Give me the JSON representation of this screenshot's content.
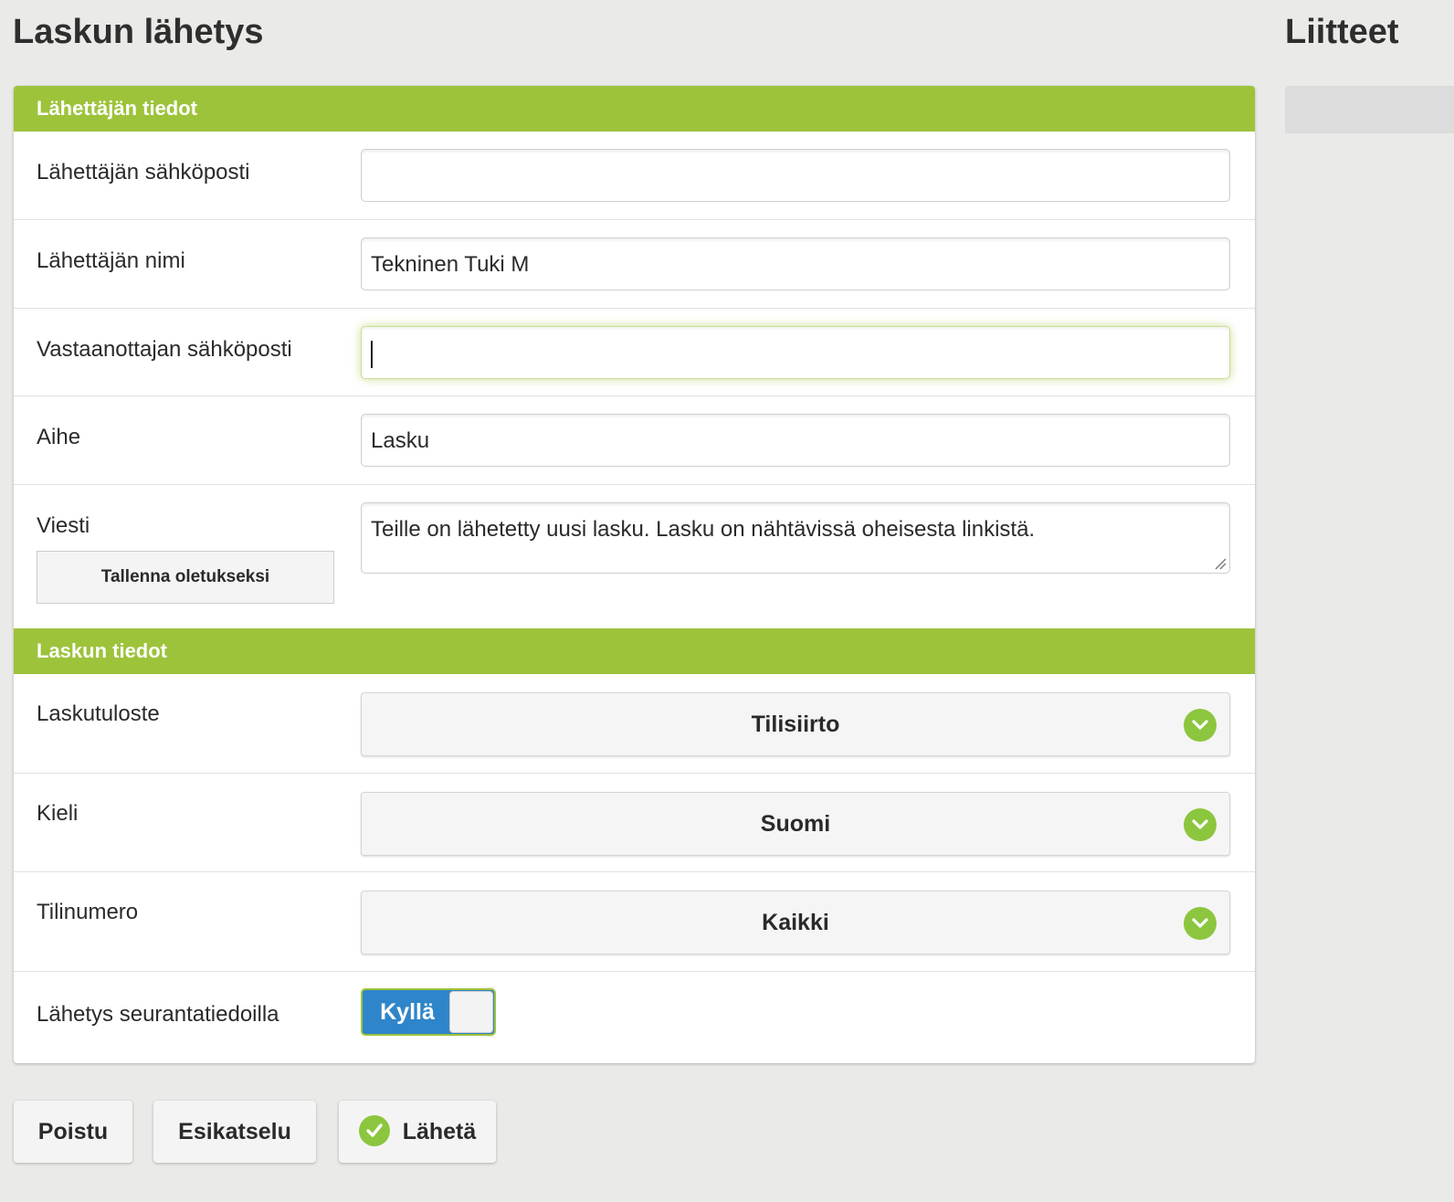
{
  "page": {
    "title": "Laskun lähetys"
  },
  "sidebar": {
    "title": "Liitteet"
  },
  "sender_section": {
    "header": "Lähettäjän tiedot",
    "fields": {
      "sender_email": {
        "label": "Lähettäjän sähköposti",
        "value": ""
      },
      "sender_name": {
        "label": "Lähettäjän nimi",
        "value": "Tekninen Tuki M"
      },
      "recipient_email": {
        "label": "Vastaanottajan sähköposti",
        "value": ""
      },
      "subject": {
        "label": "Aihe",
        "value": "Lasku"
      },
      "message": {
        "label": "Viesti",
        "value": "Teille on lähetetty uusi lasku. Lasku on nähtävissä oheisesta linkistä.",
        "save_default_label": "Tallenna oletukseksi"
      }
    }
  },
  "invoice_section": {
    "header": "Laskun tiedot",
    "fields": {
      "print_template": {
        "label": "Laskutuloste",
        "selected": "Tilisiirto",
        "icon": "chevron-down-icon"
      },
      "language": {
        "label": "Kieli",
        "selected": "Suomi",
        "icon": "chevron-down-icon"
      },
      "account_number": {
        "label": "Tilinumero",
        "selected": "Kaikki",
        "icon": "chevron-down-icon"
      },
      "tracking": {
        "label": "Lähetys seurantatiedoilla",
        "toggle_label": "Kyllä",
        "on": true
      }
    }
  },
  "actions": {
    "exit_label": "Poistu",
    "preview_label": "Esikatselu",
    "send_label": "Lähetä",
    "send_icon": "check-icon"
  },
  "colors": {
    "accent": "#9dc33b",
    "icon_green": "#8cc63e",
    "toggle_blue": "#2f85c9",
    "background": "#eaeae8"
  }
}
